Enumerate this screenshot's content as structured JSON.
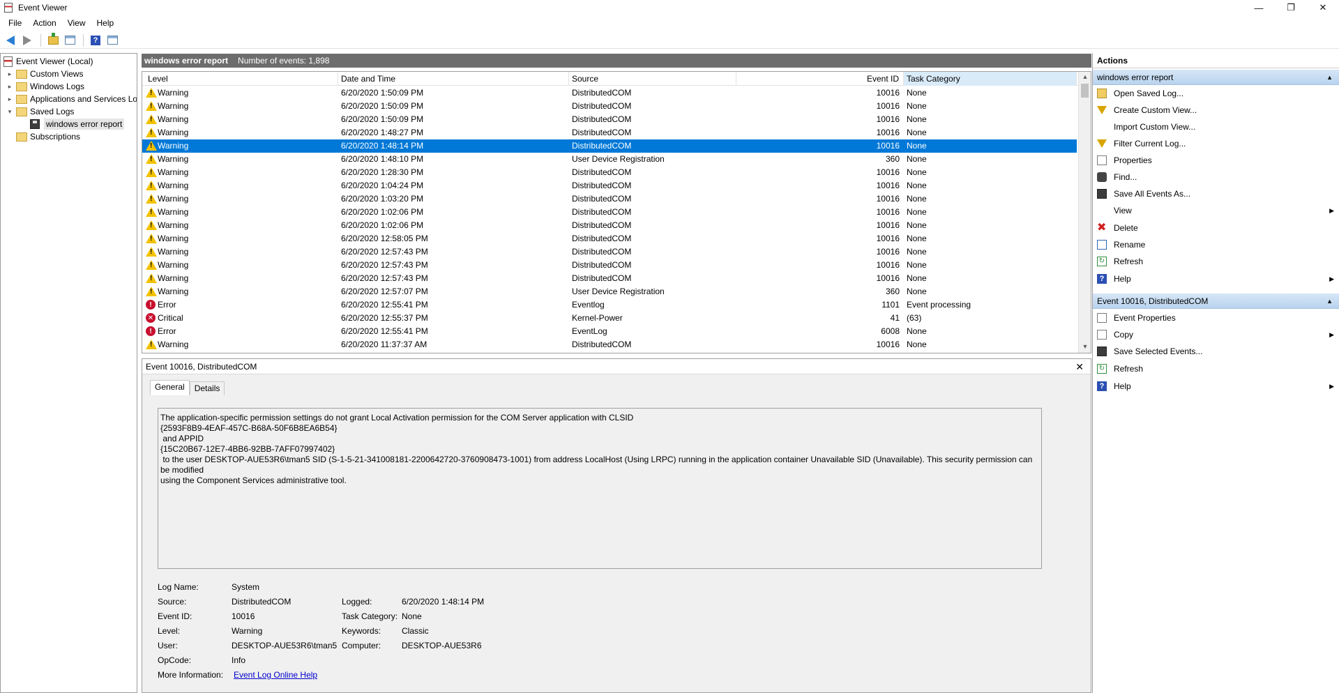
{
  "window": {
    "title": "Event Viewer",
    "minimize": "—",
    "restore": "❐",
    "close": "✕"
  },
  "menu": [
    "File",
    "Action",
    "View",
    "Help"
  ],
  "tree": {
    "root": "Event Viewer (Local)",
    "items": [
      "Custom Views",
      "Windows Logs",
      "Applications and Services Lo",
      "Saved Logs",
      "windows error report",
      "Subscriptions"
    ]
  },
  "list": {
    "title": "windows error report",
    "count": "Number of events: 1,898",
    "columns": [
      "Level",
      "Date and Time",
      "Source",
      "Event ID",
      "Task Category"
    ],
    "rows": [
      {
        "level": "Warning",
        "date": "6/20/2020 1:50:09 PM",
        "source": "DistributedCOM",
        "id": "10016",
        "cat": "None"
      },
      {
        "level": "Warning",
        "date": "6/20/2020 1:50:09 PM",
        "source": "DistributedCOM",
        "id": "10016",
        "cat": "None"
      },
      {
        "level": "Warning",
        "date": "6/20/2020 1:50:09 PM",
        "source": "DistributedCOM",
        "id": "10016",
        "cat": "None"
      },
      {
        "level": "Warning",
        "date": "6/20/2020 1:48:27 PM",
        "source": "DistributedCOM",
        "id": "10016",
        "cat": "None"
      },
      {
        "level": "Warning",
        "date": "6/20/2020 1:48:14 PM",
        "source": "DistributedCOM",
        "id": "10016",
        "cat": "None"
      },
      {
        "level": "Warning",
        "date": "6/20/2020 1:48:10 PM",
        "source": "User Device Registration",
        "id": "360",
        "cat": "None"
      },
      {
        "level": "Warning",
        "date": "6/20/2020 1:28:30 PM",
        "source": "DistributedCOM",
        "id": "10016",
        "cat": "None"
      },
      {
        "level": "Warning",
        "date": "6/20/2020 1:04:24 PM",
        "source": "DistributedCOM",
        "id": "10016",
        "cat": "None"
      },
      {
        "level": "Warning",
        "date": "6/20/2020 1:03:20 PM",
        "source": "DistributedCOM",
        "id": "10016",
        "cat": "None"
      },
      {
        "level": "Warning",
        "date": "6/20/2020 1:02:06 PM",
        "source": "DistributedCOM",
        "id": "10016",
        "cat": "None"
      },
      {
        "level": "Warning",
        "date": "6/20/2020 1:02:06 PM",
        "source": "DistributedCOM",
        "id": "10016",
        "cat": "None"
      },
      {
        "level": "Warning",
        "date": "6/20/2020 12:58:05 PM",
        "source": "DistributedCOM",
        "id": "10016",
        "cat": "None"
      },
      {
        "level": "Warning",
        "date": "6/20/2020 12:57:43 PM",
        "source": "DistributedCOM",
        "id": "10016",
        "cat": "None"
      },
      {
        "level": "Warning",
        "date": "6/20/2020 12:57:43 PM",
        "source": "DistributedCOM",
        "id": "10016",
        "cat": "None"
      },
      {
        "level": "Warning",
        "date": "6/20/2020 12:57:43 PM",
        "source": "DistributedCOM",
        "id": "10016",
        "cat": "None"
      },
      {
        "level": "Warning",
        "date": "6/20/2020 12:57:07 PM",
        "source": "User Device Registration",
        "id": "360",
        "cat": "None"
      },
      {
        "level": "Error",
        "date": "6/20/2020 12:55:41 PM",
        "source": "Eventlog",
        "id": "1101",
        "cat": "Event processing"
      },
      {
        "level": "Critical",
        "date": "6/20/2020 12:55:37 PM",
        "source": "Kernel-Power",
        "id": "41",
        "cat": "(63)"
      },
      {
        "level": "Error",
        "date": "6/20/2020 12:55:41 PM",
        "source": "EventLog",
        "id": "6008",
        "cat": "None"
      },
      {
        "level": "Warning",
        "date": "6/20/2020 11:37:37 AM",
        "source": "DistributedCOM",
        "id": "10016",
        "cat": "None"
      }
    ]
  },
  "details": {
    "header": "Event 10016, DistributedCOM",
    "tabs": [
      "General",
      "Details"
    ],
    "message": "The application-specific permission settings do not grant Local Activation permission for the COM Server application with CLSID\n{2593F8B9-4EAF-457C-B68A-50F6B8EA6B54}\n and APPID\n{15C20B67-12E7-4BB6-92BB-7AFF07997402}\n to the user DESKTOP-AUE53R6\\tman5 SID (S-1-5-21-341008181-2200642720-3760908473-1001) from address LocalHost (Using LRPC) running in the application container Unavailable SID (Unavailable). This security permission can be modified\nusing the Component Services administrative tool.",
    "fields": {
      "log_name_label": "Log Name:",
      "log_name": "System",
      "source_label": "Source:",
      "source": "DistributedCOM",
      "logged_label": "Logged:",
      "logged": "6/20/2020 1:48:14 PM",
      "event_id_label": "Event ID:",
      "event_id": "10016",
      "task_label": "Task Category:",
      "task": "None",
      "level_label": "Level:",
      "level": "Warning",
      "keywords_label": "Keywords:",
      "keywords": "Classic",
      "user_label": "User:",
      "user": "DESKTOP-AUE53R6\\tman5",
      "computer_label": "Computer:",
      "computer": "DESKTOP-AUE53R6",
      "opcode_label": "OpCode:",
      "opcode": "Info",
      "more_label": "More Information:",
      "more_link": "Event Log Online Help"
    }
  },
  "actions": {
    "header": "Actions",
    "section1": "windows error report",
    "section1_items": [
      "Open Saved Log...",
      "Create Custom View...",
      "Import Custom View...",
      "Filter Current Log...",
      "Properties",
      "Find...",
      "Save All Events As...",
      "View",
      "Delete",
      "Rename",
      "Refresh",
      "Help"
    ],
    "section2": "Event 10016, DistributedCOM",
    "section2_items": [
      "Event Properties",
      "Copy",
      "Save Selected Events...",
      "Refresh",
      "Help"
    ]
  }
}
